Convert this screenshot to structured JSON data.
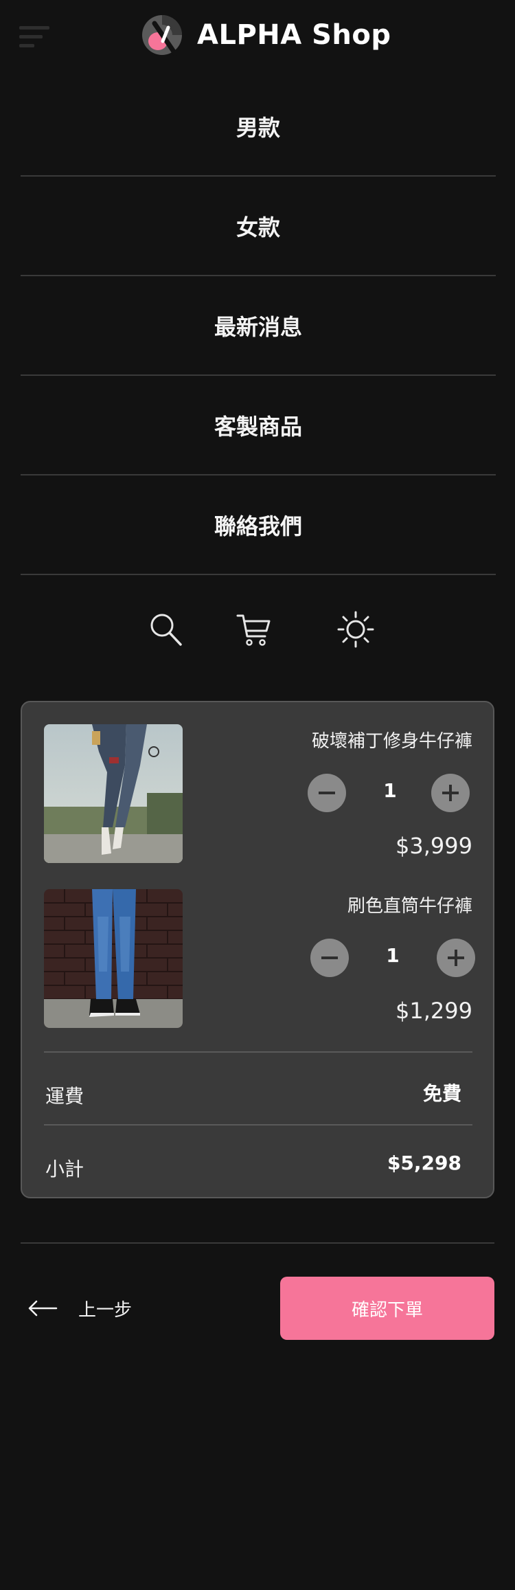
{
  "header": {
    "brand": "ALPHA Shop",
    "brand_color": "#f67599"
  },
  "nav": {
    "items": [
      {
        "label": "男款"
      },
      {
        "label": "女款"
      },
      {
        "label": "最新消息"
      },
      {
        "label": "客製商品"
      },
      {
        "label": "聯絡我們"
      }
    ]
  },
  "toolbar": {
    "icons": [
      "search-icon",
      "cart-icon",
      "theme-toggle-icon"
    ]
  },
  "cart": {
    "items": [
      {
        "name": "破壞補丁修身牛仔褲",
        "quantity": "1",
        "price": "$3,999",
        "image": "ripped-jeans-photo"
      },
      {
        "name": "刷色直筒牛仔褲",
        "quantity": "1",
        "price": "$1,299",
        "image": "washed-straight-jeans-photo"
      }
    ],
    "shipping": {
      "label": "運費",
      "value": "免費"
    },
    "subtotal": {
      "label": "小計",
      "value": "$5,298"
    }
  },
  "actions": {
    "back_label": "上一步",
    "confirm_label": "確認下單",
    "confirm_color": "#f67599"
  }
}
